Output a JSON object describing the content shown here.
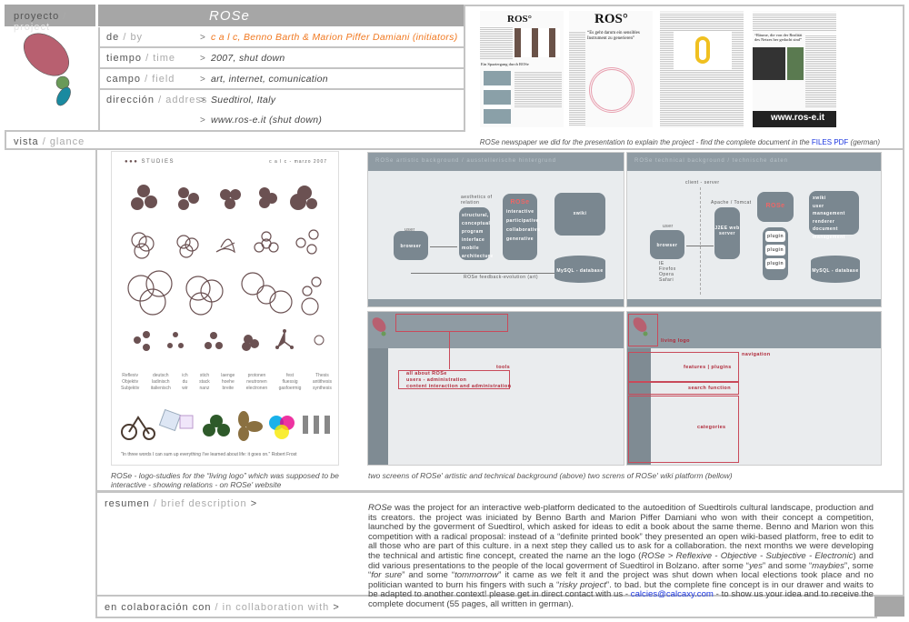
{
  "header": {
    "section_es": "proyecto",
    "section_en": "project",
    "title": "ROSe"
  },
  "details": [
    {
      "key_es": "de",
      "key_en": "by",
      "value": "c a l c, Benno Barth & Marion Piffer Damiani (initiators)"
    },
    {
      "key_es": "tiempo",
      "key_en": "time",
      "value": "2007, shut down"
    },
    {
      "key_es": "campo",
      "key_en": "field",
      "value": "art, internet, comunication"
    },
    {
      "key_es": "dirección",
      "key_en": "address",
      "value": "Suedtirol, Italy"
    },
    {
      "key_es": "",
      "key_en": "",
      "value": "www.ros-e.it (shut down)"
    }
  ],
  "separator": "/",
  "gt": ">",
  "vista": {
    "es": "vista",
    "en": "glance"
  },
  "newspaper": {
    "mastheads": [
      "ROS°",
      "ROS°"
    ],
    "headline": "“Es geht darum ein sensibles Instrument zu generieren”",
    "headline2": "“Räume, die von der Realität des Netzes her gedacht sind”",
    "sub": "Ein Spaziergang durch ROSe",
    "url": "www.ros-e.it",
    "caption_pre": "ROSe newspaper we did for the presentation to explain the project - find the complete document in the ",
    "caption_link": "FILES PDF",
    "caption_post": " (german)"
  },
  "studies": {
    "brand": "STUDIES",
    "date": "c a l c - marzo 2007",
    "words": [
      [
        "Reflexiv",
        "Objektiv",
        "Subjektiv"
      ],
      [
        "deutsch",
        "ladinisch",
        "italienisch"
      ],
      [
        "ich",
        "du",
        "wir"
      ],
      [
        "stich",
        "stack",
        "nanz"
      ],
      [
        "laenge",
        "hoehe",
        "breite"
      ],
      [
        "protonen",
        "neutronen",
        "electronen"
      ],
      [
        "fest",
        "fluessig",
        "gasfoermig"
      ],
      [
        "Thesis",
        "antithesis",
        "synthesis"
      ]
    ],
    "quote": "\"In three words I can sum up everything I've learned about life: it goes on.\"   Robert Frost",
    "caption": "ROSe - logo-studies for the “living logo” which was supposed to be interactive - showing relations - on ROSe' website"
  },
  "diagram1": {
    "title": "ROSe artistic background / ausstellerische hintergrund",
    "user": "user",
    "browser": "browser",
    "aesthetics": "aesthetics of relation",
    "list": [
      "structural, conceptual",
      "program",
      "interface",
      "mobile architecture"
    ],
    "rose": "ROSe",
    "props": [
      "interactive",
      "participative",
      "collaborative",
      "generative"
    ],
    "wiki": "xwiki",
    "db": "MySQL - database",
    "feedback": "ROSe feedback-evolution (art)"
  },
  "diagram2": {
    "title": "ROSe technical background / technische daten",
    "client": "client - server",
    "user": "user",
    "browser": "browser",
    "browsers": [
      "IE",
      "Firefox",
      "Opera",
      "Safari"
    ],
    "apache": "Apache / Tomcat",
    "server": "J2EE web server",
    "rose": "ROSe",
    "plugins": [
      "plugin",
      "plugin",
      "plugin"
    ],
    "wiki": "xwiki",
    "wiki_items": [
      "user management",
      "renderer",
      "document management"
    ],
    "db": "MySQL - database"
  },
  "screen1": {
    "tools": "tools",
    "items": [
      "all about ROSe",
      "users - administration",
      "content interaction and administration"
    ]
  },
  "screen2": {
    "living": "living logo",
    "nav": "navigation",
    "features": "features | plugins",
    "search": "search function",
    "categories": "categories"
  },
  "screens_caption": "two screens of ROSe' artistic and technical background (above) two screns of ROSe' wiki platform (bellow)",
  "resumen": {
    "es": "resumen",
    "en": "brief description",
    "text_rose": "ROSe",
    "text1": " was the project for an interactive web-platform dedicated to the autoedition of Suedtirols cultural landscape, production and its creators. the project was iniciated by Benno Barth and Marion Piffer Damiani who won with their concept a competition, launched by the goverment of Suedtirol, which asked for ideas to edit a book about the same theme. Benno and Marion won this competition with a radical proposal: instead of a “definite printed book” they presented an open wiki-based platform, free to edit to all those who are part of this culture. in a next step they called us to ask for a collaboration. the next months we were developing the technical and artistic fine concept, created the name an the logo (",
    "text_italic1": "ROSe > Reflexive - Objective - Subjective - Electronic",
    "text2": ") and did various presentations to the people of the local goverment of Suedtirol in Bolzano. after some “",
    "yes": "yes",
    "text3": "” and some “",
    "maybies": "maybies",
    "text4": "”, some “",
    "forsure": "for sure",
    "text5": "” and some “",
    "tommorrow": "tommorrow",
    "text6": "” it came as we felt it and the project was shut down when local elections took place and no politician wanted to burn his fingers with such a “",
    "risky": "risky project",
    "text7": "”. to bad. but the complete fine concept is in our drawer and waits to be adapted to another context! please get in direct contact with us - ",
    "email": "calcies@calcaxy.com",
    "text8": " - to show us your idea and to receive the complete document (55 pages, all written in german)."
  },
  "collab": {
    "es": "en colaboración con",
    "en": "in collaboration with"
  },
  "colors": {
    "header": "#a6a6a6",
    "accent": "#f07820",
    "link": "#1a35e0",
    "logo_pink": "#b86070",
    "logo_green": "#6a9a58",
    "logo_blue": "#1a8aa0"
  }
}
